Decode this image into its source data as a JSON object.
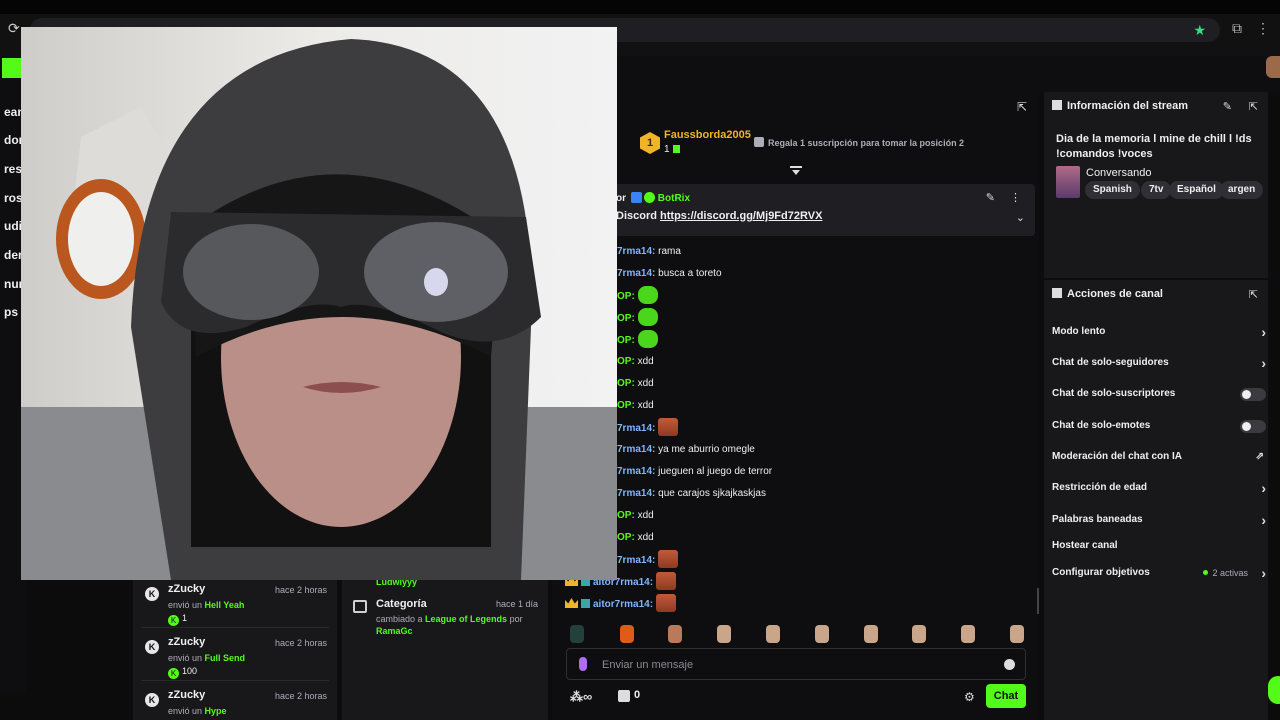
{
  "browser": {
    "title": ""
  },
  "leftnav": {
    "items": [
      "eam",
      "dor",
      "res",
      "ros",
      "udie",
      "der",
      "nun",
      "ps"
    ]
  },
  "feed": {
    "items": [
      {
        "user": "zZucky",
        "ago": "hace 2 horas",
        "action": "envió un",
        "item": "Hell Yeah",
        "amount": "1"
      },
      {
        "user": "zZucky",
        "ago": "hace 2 horas",
        "action": "envió un",
        "item": "Full Send",
        "amount": "100"
      },
      {
        "user": "zZucky",
        "ago": "hace 2 horas",
        "action": "envió un",
        "item": "Hype",
        "amount": ""
      }
    ],
    "category": {
      "cut_user": "Ludwiyyy",
      "title": "Categoría",
      "ago": "hace 1 día",
      "text_prefix": "cambiado a",
      "game": "League of Legends",
      "text_by": "por",
      "by_user": "RamaGc"
    }
  },
  "chat": {
    "leader": {
      "rank": "1",
      "name": "Faussborda2005",
      "count": "1"
    },
    "gift_hint": "Regala 1 suscripción para tomar la posición 2",
    "pinned": {
      "line1_prefix": "or",
      "bot_name": "BotRix",
      "line2_label": "Discord",
      "link": "https://discord.gg/Mj9Fd72RVX"
    },
    "messages": [
      {
        "user": "7rma14:",
        "text": "rama",
        "kind": "text"
      },
      {
        "user": "7rma14:",
        "text": "busca a toreto",
        "kind": "text"
      },
      {
        "user": "OP:",
        "text": "",
        "kind": "green"
      },
      {
        "user": "OP:",
        "text": "",
        "kind": "green"
      },
      {
        "user": "OP:",
        "text": "",
        "kind": "green"
      },
      {
        "user": "OP:",
        "text": "xdd",
        "kind": "text"
      },
      {
        "user": "OP:",
        "text": "xdd",
        "kind": "text"
      },
      {
        "user": "OP:",
        "text": "xdd",
        "kind": "text"
      },
      {
        "user": "7rma14:",
        "text": "",
        "kind": "face"
      },
      {
        "user": "7rma14:",
        "text": "ya me aburrio omegle",
        "kind": "text"
      },
      {
        "user": "7rma14:",
        "text": "jueguen al juego de terror",
        "kind": "text"
      },
      {
        "user": "7rma14:",
        "text": "que carajos sjkajkaskjas",
        "kind": "text"
      },
      {
        "user": "OP:",
        "text": "xdd",
        "kind": "text"
      },
      {
        "user": "OP:",
        "text": "xdd",
        "kind": "text"
      },
      {
        "user": "7rma14:",
        "text": "",
        "kind": "face"
      },
      {
        "user": "aitor7rma14:",
        "text": "",
        "kind": "face"
      },
      {
        "user": "aitor7rma14:",
        "text": "",
        "kind": "face"
      }
    ],
    "input_placeholder": "Enviar un mensaje",
    "points": "0",
    "send_label": "Chat"
  },
  "stream_info": {
    "title": "Información del stream",
    "stream_title": "Dia de la memoria l mine de chill l !ds !comandos !voces",
    "category": "Conversando",
    "tags": [
      "Spanish",
      "7tv",
      "Español",
      "argen"
    ]
  },
  "channel_actions": {
    "title": "Acciones de canal",
    "items": [
      {
        "label": "Modo lento",
        "control": "chevron"
      },
      {
        "label": "Chat de solo-seguidores",
        "control": "chevron"
      },
      {
        "label": "Chat de solo-suscriptores",
        "control": "toggle"
      },
      {
        "label": "Chat de solo-emotes",
        "control": "toggle"
      },
      {
        "label": "Moderación del chat con IA",
        "control": "external"
      },
      {
        "label": "Restricción de edad",
        "control": "chevron"
      },
      {
        "label": "Palabras baneadas",
        "control": "chevron"
      },
      {
        "label": "Hostear canal",
        "control": "none"
      },
      {
        "label": "Configurar objetivos",
        "control": "chevron",
        "status": "2 activas"
      }
    ]
  },
  "colors": {
    "accent": "#53fc18",
    "bg": "#0e0e10",
    "panel": "#18181b",
    "gold": "#f0b429"
  }
}
